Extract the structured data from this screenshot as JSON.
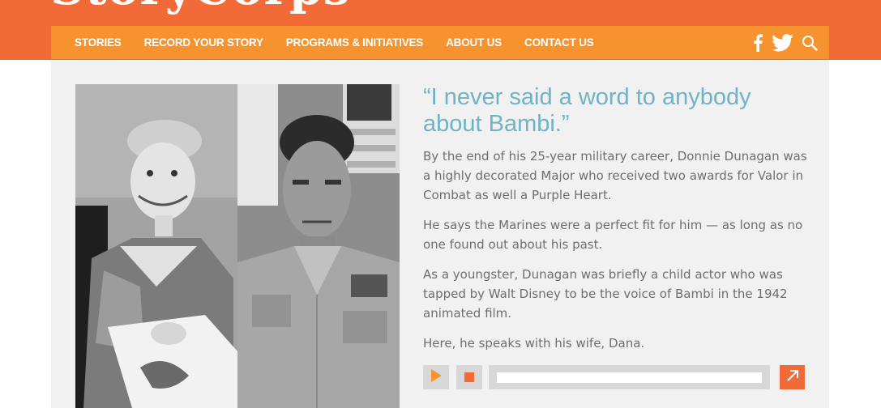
{
  "site": {
    "logo_text": "StoryCorps"
  },
  "nav": {
    "items": [
      {
        "id": "stories",
        "label": "STORIES"
      },
      {
        "id": "record",
        "label": "RECORD YOUR STORY"
      },
      {
        "id": "programs",
        "label": "PROGRAMS & INITIATIVES"
      },
      {
        "id": "about",
        "label": "ABOUT US"
      },
      {
        "id": "contact",
        "label": "CONTACT US"
      }
    ],
    "icons": [
      "facebook-icon",
      "twitter-icon",
      "search-icon"
    ]
  },
  "story": {
    "quote": "“I never said a word to anybody about Bambi.”",
    "paragraphs": [
      "By the end of his 25-year military career, Donnie Dunagan was a highly decorated Major who received two awards for Valor in Combat as well a Purple Heart.",
      "He says the Marines were a perfect fit for him — as long as no one found out about his past.",
      "As a youngster, Dunagan was briefly a child actor who was tapped by Walt Disney to be the voice of Bambi in the 1942 animated film.",
      "Here, he speaks with his wife, Dana."
    ]
  },
  "player": {
    "controls": [
      "play-icon",
      "stop-icon",
      "external-link-icon"
    ],
    "progress": 0
  },
  "colors": {
    "header_orange": "#f26a37",
    "nav_orange": "#f7932f",
    "quote_teal": "#6fb3c5",
    "body_text": "#6e6e6e",
    "panel_bg": "#f1f1f1",
    "control_gray": "#d7d7d7"
  }
}
